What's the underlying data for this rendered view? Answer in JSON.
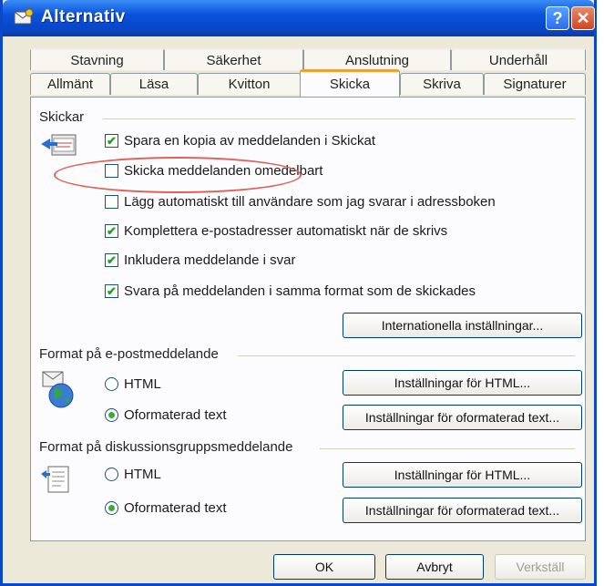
{
  "window": {
    "title": "Alternativ",
    "help_label": "?",
    "close_label": "✕"
  },
  "tabs": {
    "row1": [
      "Stavning",
      "Säkerhet",
      "Anslutning",
      "Underhåll"
    ],
    "row2": [
      "Allmänt",
      "Läsa",
      "Kvitton",
      "Skicka",
      "Skriva",
      "Signaturer"
    ],
    "active": "Skicka"
  },
  "skickar": {
    "heading": "Skickar",
    "options": [
      {
        "label": "Spara en kopia av meddelanden i Skickat",
        "checked": true
      },
      {
        "label": "Skicka meddelanden omedelbart",
        "checked": false
      },
      {
        "label": "Lägg automatiskt till användare som jag svarar i adressboken",
        "checked": false
      },
      {
        "label": "Komplettera e-postadresser automatiskt när de skrivs",
        "checked": true
      },
      {
        "label": "Inkludera meddelande i svar",
        "checked": true
      },
      {
        "label": "Svara på meddelanden i samma format som de skickades",
        "checked": true
      }
    ],
    "intl_button": "Internationella inställningar..."
  },
  "mail_format": {
    "heading": "Format på e-postmeddelande",
    "html_label": "HTML",
    "plain_label": "Oformaterad text",
    "selected": "plain",
    "html_settings_button": "Inställningar för HTML...",
    "plain_settings_button": "Inställningar för oformaterad text..."
  },
  "news_format": {
    "heading": "Format på diskussionsgruppsmeddelande",
    "html_label": "HTML",
    "plain_label": "Oformaterad text",
    "selected": "plain",
    "html_settings_button": "Inställningar för HTML...",
    "plain_settings_button": "Inställningar för oformaterad text..."
  },
  "footer": {
    "ok": "OK",
    "cancel": "Avbryt",
    "apply": "Verkställ"
  },
  "colors": {
    "title_blue": "#0a52dc",
    "accent_orange": "#f0a030",
    "highlight_red": "#e06055"
  }
}
